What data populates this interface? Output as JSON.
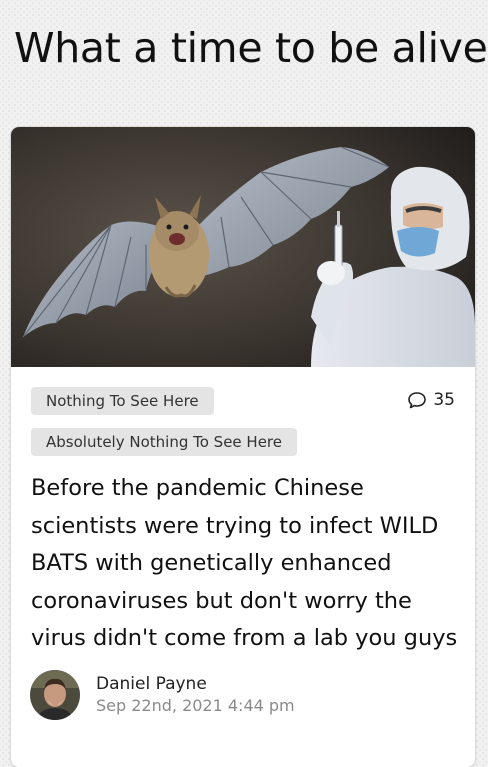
{
  "page": {
    "title": "What a time to be alive"
  },
  "post": {
    "tags": [
      "Nothing To See Here",
      "Absolutely Nothing To See Here"
    ],
    "comment_icon": "speech-bubble-icon",
    "comment_count": "35",
    "headline": "Before the pandemic Chinese scientists were trying to infect WILD BATS with genetically enhanced coronaviruses but don't worry the virus didn't come from a lab you guys",
    "image": "photo of a bat in flight and a scientist in a white protective suit holding a syringe",
    "author": {
      "name": "Daniel Payne",
      "date": "Sep 22nd, 2021 4:44 pm"
    }
  },
  "colors": {
    "tag_background": "#e4e4e4",
    "card_background": "#ffffff",
    "date_text": "#8a8a8a"
  }
}
